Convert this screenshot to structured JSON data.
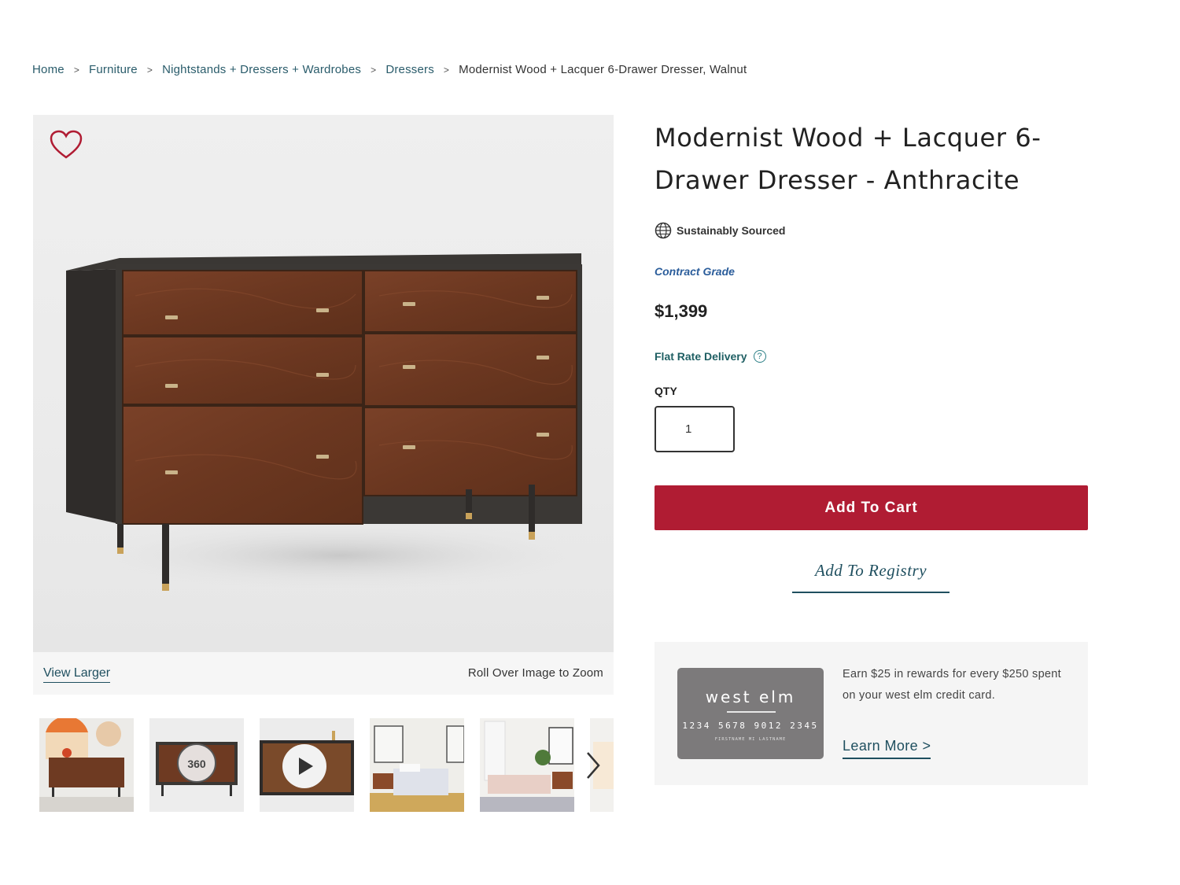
{
  "breadcrumb": {
    "items": [
      "Home",
      "Furniture",
      "Nightstands + Dressers + Wardrobes",
      "Dressers"
    ],
    "separator": ">",
    "current": "Modernist Wood + Lacquer 6-Drawer Dresser, Walnut"
  },
  "gallery": {
    "favorite_icon": "heart-outline-icon",
    "view_larger": "View Larger",
    "zoom_hint": "Roll Over Image to Zoom",
    "thumb_360_label": "360",
    "next_icon": "chevron-right-icon"
  },
  "product": {
    "title": "Modernist Wood + Lacquer 6-Drawer Dresser - Anthracite",
    "sustainably_sourced": "Sustainably Sourced",
    "contract_grade": "Contract Grade",
    "price": "$1,399",
    "delivery": "Flat Rate Delivery",
    "delivery_help": "?",
    "qty_label": "QTY",
    "qty_value": "1",
    "add_to_cart": "Add To Cart",
    "add_to_registry": "Add To Registry"
  },
  "promo": {
    "card_brand": "west elm",
    "card_number": "1234 5678 9012 2345",
    "card_name": "FIRSTNAME MI LASTNAME",
    "text": "Earn $25 in rewards for every $250 spent on your west elm credit card.",
    "learn_more": "Learn More >"
  },
  "colors": {
    "accent_red": "#b01c33",
    "link_teal": "#1f4f5f",
    "contract_blue": "#2b5d9b"
  }
}
